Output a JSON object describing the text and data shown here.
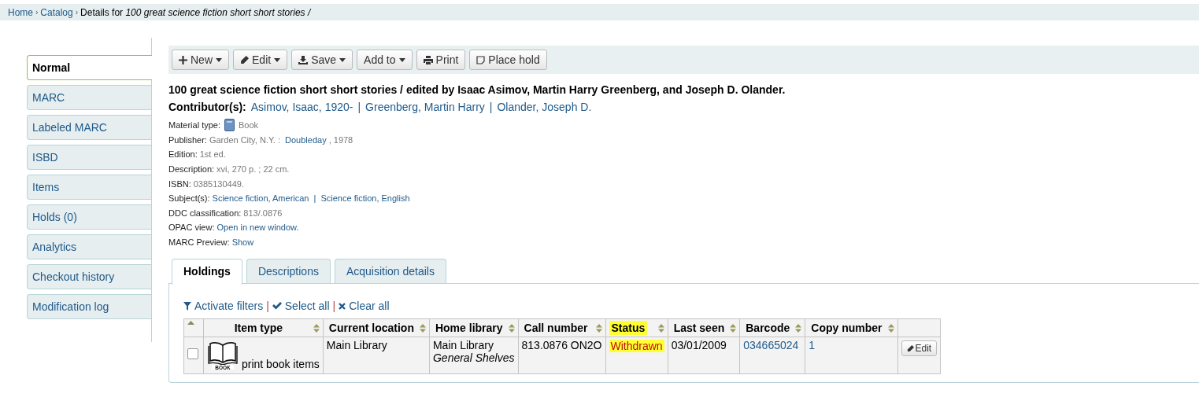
{
  "breadcrumb": {
    "separator": "›",
    "links": [
      "Home",
      "Catalog"
    ],
    "current_prefix": "Details for",
    "current_title": "100 great science fiction short short stories /"
  },
  "sidebar": {
    "items": [
      {
        "label": "Normal",
        "selected": true
      },
      {
        "label": "MARC",
        "selected": false
      },
      {
        "label": "Labeled MARC",
        "selected": false
      },
      {
        "label": "ISBD",
        "selected": false
      },
      {
        "label": "Items",
        "selected": false
      },
      {
        "label": "Holds (0)",
        "selected": false
      },
      {
        "label": "Analytics",
        "selected": false
      },
      {
        "label": "Checkout history",
        "selected": false
      },
      {
        "label": "Modification log",
        "selected": false
      }
    ]
  },
  "toolbar": {
    "buttons": [
      {
        "label": "New",
        "dropdown": true
      },
      {
        "label": "Edit",
        "dropdown": true
      },
      {
        "label": "Save",
        "dropdown": true
      },
      {
        "label": "Add to",
        "dropdown": true
      },
      {
        "label": "Print",
        "dropdown": false
      },
      {
        "label": "Place hold",
        "dropdown": false
      }
    ]
  },
  "record": {
    "title": "100 great science fiction short short stories / edited by Isaac Asimov, Martin Harry Greenberg, and Joseph D. Olander.",
    "contributors_label": "Contributor(s):",
    "contributors_separator": "|",
    "contributors": [
      "Asimov, Isaac, 1920-",
      "Greenberg, Martin Harry",
      "Olander, Joseph D."
    ],
    "details": [
      {
        "label": "Material type:",
        "parts": [
          {
            "text": "Book",
            "kind": "plain"
          }
        ]
      },
      {
        "label": "Publisher:",
        "parts": [
          {
            "text": "Garden City, N.Y. : ",
            "kind": "plain"
          },
          {
            "text": "Doubleday",
            "kind": "link"
          },
          {
            "text": ", 1978",
            "kind": "plain"
          }
        ]
      },
      {
        "label": "Edition:",
        "parts": [
          {
            "text": "1st ed.",
            "kind": "plain"
          }
        ]
      },
      {
        "label": "Description:",
        "parts": [
          {
            "text": "xvi, 270 p. ; 22 cm.",
            "kind": "plain"
          }
        ]
      },
      {
        "label": "ISBN:",
        "parts": [
          {
            "text": "0385130449.",
            "kind": "plain"
          }
        ]
      },
      {
        "label": "Subject(s):",
        "parts": [
          {
            "text": "Science fiction, American",
            "kind": "link"
          },
          {
            "text": " | ",
            "kind": "sep"
          },
          {
            "text": "Science fiction, English",
            "kind": "link"
          }
        ]
      },
      {
        "label": "DDC classification:",
        "parts": [
          {
            "text": "813/.0876",
            "kind": "plain"
          }
        ]
      },
      {
        "label": "OPAC view:",
        "parts": [
          {
            "text": "Open in new window.",
            "kind": "link"
          }
        ]
      },
      {
        "label": "MARC Preview:",
        "parts": [
          {
            "text": "Show",
            "kind": "link"
          }
        ]
      }
    ]
  },
  "tabs": [
    {
      "label": "Holdings",
      "selected": true
    },
    {
      "label": "Descriptions",
      "selected": false
    },
    {
      "label": "Acquisition details",
      "selected": false
    }
  ],
  "actions_separator": "|",
  "actions": [
    {
      "label": "Activate filters"
    },
    {
      "label": "Select all"
    },
    {
      "label": "Clear all"
    }
  ],
  "table": {
    "columns": [
      {
        "highlighted": false
      },
      {
        "label": "Item type",
        "highlighted": false
      },
      {
        "label": "Current location",
        "highlighted": false
      },
      {
        "label": "Home library",
        "highlighted": false
      },
      {
        "label": "Call number",
        "highlighted": false
      },
      {
        "label": "Status",
        "highlighted": true
      },
      {
        "label": "Last seen",
        "highlighted": false
      },
      {
        "label": "Barcode",
        "highlighted": false
      },
      {
        "label": "Copy number",
        "highlighted": false
      },
      {
        "highlighted": false
      }
    ],
    "rows": [
      {
        "checked": false,
        "item_type_image_label": "BOOK",
        "item_type": "print book items",
        "current_location": "Main Library",
        "home_library": "Main Library",
        "shelving": "General Shelves",
        "call_number": "813.0876 ON2O",
        "status": "Withdrawn",
        "status_highlighted": true,
        "last_seen": "03/01/2009",
        "barcode": "034665024",
        "copy_number": "1",
        "action": "Edit"
      }
    ]
  }
}
